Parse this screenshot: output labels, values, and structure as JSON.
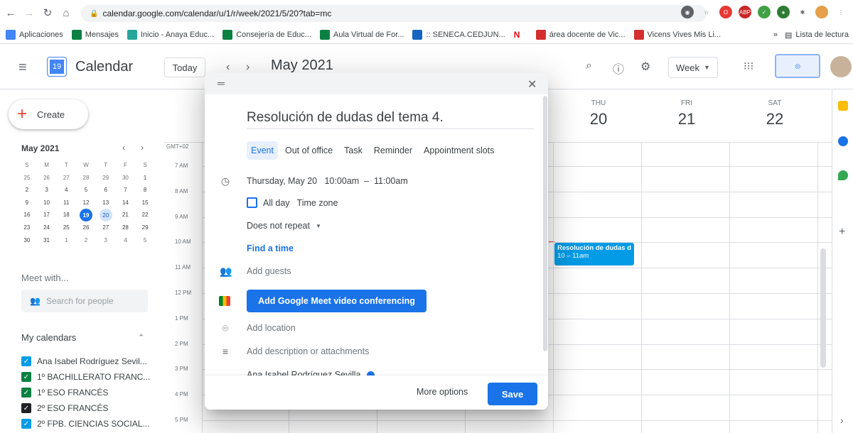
{
  "browser": {
    "url": "calendar.google.com/calendar/u/1/r/week/2021/5/20?tab=mc",
    "bookmarks": [
      "Aplicaciones",
      "Mensajes",
      "Inicio - Anaya Educ...",
      "Consejería de Educ...",
      "Aula Virtual de For...",
      ":: SENECA.CEDJUN...",
      "área docente de Vic...",
      "Vicens Vives Mis Li..."
    ],
    "reading_list": "Lista de lectura",
    "more_bookmarks": "»"
  },
  "header": {
    "app_name": "Calendar",
    "logo_day": "19",
    "today_label": "Today",
    "month_title": "May 2021",
    "view_label": "Week"
  },
  "sidebar": {
    "create_label": "Create",
    "mini_month": "May 2021",
    "dow": [
      "S",
      "M",
      "T",
      "W",
      "T",
      "F",
      "S"
    ],
    "weeks": [
      [
        "25",
        "26",
        "27",
        "28",
        "29",
        "30",
        "1"
      ],
      [
        "2",
        "3",
        "4",
        "5",
        "6",
        "7",
        "8"
      ],
      [
        "9",
        "10",
        "11",
        "12",
        "13",
        "14",
        "15"
      ],
      [
        "16",
        "17",
        "18",
        "19",
        "20",
        "21",
        "22"
      ],
      [
        "23",
        "24",
        "25",
        "26",
        "27",
        "28",
        "29"
      ],
      [
        "30",
        "31",
        "1",
        "2",
        "3",
        "4",
        "5"
      ]
    ],
    "today": "19",
    "selected": "20",
    "meet_with": "Meet with...",
    "search_placeholder": "Search for people",
    "my_calendars": "My calendars",
    "calendars": [
      {
        "name": "Ana Isabel Rodríguez Sevil...",
        "color": "#039be5"
      },
      {
        "name": "1º BACHILLERATO FRANC...",
        "color": "#0b8043"
      },
      {
        "name": "1º ESO FRANCÉS",
        "color": "#0b8043"
      },
      {
        "name": "2º ESO FRANCÉS",
        "color": "#202124"
      },
      {
        "name": "2º FPB. CIENCIAS SOCIAL...",
        "color": "#039be5"
      }
    ]
  },
  "grid": {
    "days": [
      {
        "dow": "THU",
        "date": "20"
      },
      {
        "dow": "FRI",
        "date": "21"
      },
      {
        "dow": "SAT",
        "date": "22"
      }
    ],
    "gmt": "GMT+02",
    "hours": [
      "7 AM",
      "8 AM",
      "9 AM",
      "10 AM",
      "11 AM",
      "12 PM",
      "1 PM",
      "2 PM",
      "3 PM",
      "4 PM",
      "5 PM"
    ],
    "event_title": "Resolución de dudas d",
    "event_time": "10 – 11am"
  },
  "dialog": {
    "title": "Resolución de dudas del tema 4.",
    "tabs": [
      "Event",
      "Out of office",
      "Task",
      "Reminder",
      "Appointment slots"
    ],
    "date_time": "Thursday, May 20   10:00am  –  11:00am",
    "all_day": "All day",
    "time_zone": "Time zone",
    "repeat": "Does not repeat",
    "find_time": "Find a time",
    "add_guests": "Add guests",
    "meet_button": "Add Google Meet video conferencing",
    "add_location": "Add location",
    "add_description": "Add description or attachments",
    "owner": "Ana Isabel Rodríguez Sevilla",
    "more_options": "More options",
    "save": "Save"
  }
}
